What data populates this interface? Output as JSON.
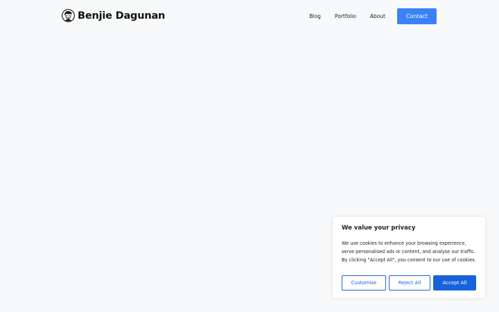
{
  "header": {
    "brand_name": "Benjie Dagunan",
    "brand_icon": "avatar-illustration-icon",
    "nav": {
      "blog": "Blog",
      "portfolio": "Portfolio",
      "about": "About"
    },
    "contact_label": "Contact"
  },
  "cookie_banner": {
    "title": "We value your privacy",
    "body": "We use cookies to enhance your browsing experience, serve personalised ads or content, and analyse our traffic. By clicking \"Accept All\", you consent to our use of cookies.",
    "customise_label": "Customise",
    "reject_label": "Reject All",
    "accept_label": "Accept All"
  },
  "colors": {
    "page_background": "#f8f9fa",
    "contact_button": "#3b82f6",
    "cookie_accent": "#1863dc"
  }
}
